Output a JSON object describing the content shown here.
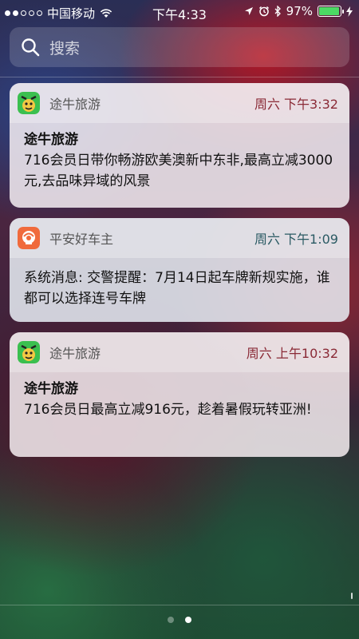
{
  "status_bar": {
    "carrier": "中国移动",
    "time": "下午4:33",
    "battery": "97%",
    "battery_level": 0.97,
    "signal_bars": 2
  },
  "search": {
    "placeholder": "搜索"
  },
  "notifications": [
    {
      "app": "途牛旅游",
      "icon": "tuniu-app-icon",
      "time": "周六 下午3:32",
      "title": "途牛旅游",
      "body": "716会员日带你畅游欧美澳新中东非,最高立减3000元,去品味异域的风景"
    },
    {
      "app": "平安好车主",
      "icon": "pingan-app-icon",
      "time": "周六 下午1:09",
      "title": "",
      "body": "系统消息: 交警提醒：7月14日起车牌新规实施，谁都可以选择连号车牌"
    },
    {
      "app": "途牛旅游",
      "icon": "tuniu-app-icon",
      "time": "周六 上午10:32",
      "title": "途牛旅游",
      "body": "716会员日最高立减916元，趁着暑假玩转亚洲!"
    }
  ],
  "pages": {
    "count": 2,
    "current": 2
  },
  "colors": {
    "accent_time": "#8a2a36",
    "battery": "#4cd964"
  }
}
